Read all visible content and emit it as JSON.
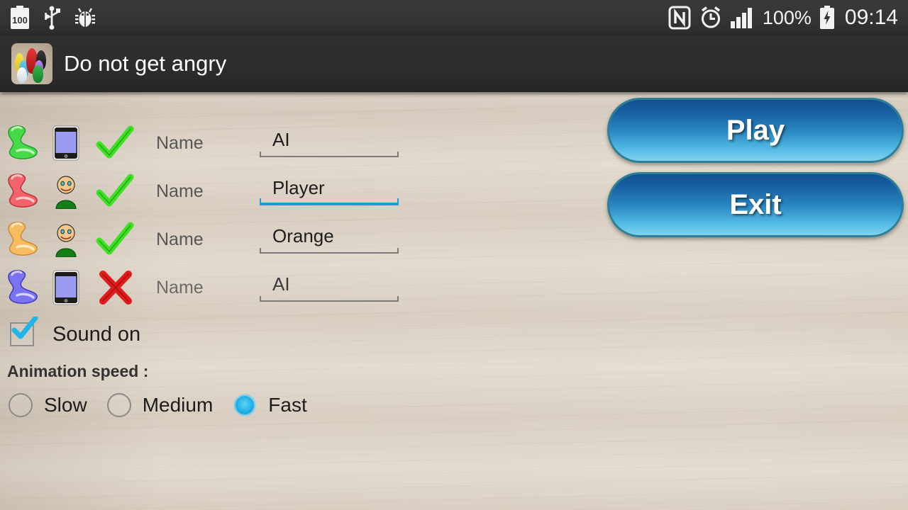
{
  "status_bar": {
    "left_icons": [
      {
        "name": "battery-100-icon",
        "label": "100"
      },
      {
        "name": "usb-icon",
        "label": "USB"
      },
      {
        "name": "debug-bug-icon",
        "label": "Debug"
      }
    ],
    "right_icons": [
      {
        "name": "nfc-icon",
        "label": "NFC"
      },
      {
        "name": "alarm-clock-icon",
        "label": "Alarm"
      },
      {
        "name": "signal-bars-icon",
        "label": "Signal"
      }
    ],
    "battery_percent": "100%",
    "charging_icon": "battery-charging-icon",
    "clock": "09:14"
  },
  "action_bar": {
    "app_icon": "game-pieces-icon",
    "title": "Do not get angry"
  },
  "players": [
    {
      "pawn_color": "#4ade4a",
      "pawn_name": "pawn-green",
      "type_icon": "phone-icon",
      "type": "AI",
      "enabled_icon": "green-check-icon",
      "enabled": true,
      "name_label": "Name",
      "name_value": "AI",
      "name_placeholder": "Name",
      "focused": false
    },
    {
      "pawn_color": "#f36a6a",
      "pawn_name": "pawn-red",
      "type_icon": "person-icon",
      "type": "Human",
      "enabled_icon": "green-check-icon",
      "enabled": true,
      "name_label": "Name",
      "name_value": "Player",
      "name_placeholder": "Name",
      "focused": true
    },
    {
      "pawn_color": "#f5b35c",
      "pawn_name": "pawn-orange",
      "type_icon": "person-icon",
      "type": "Human",
      "enabled_icon": "green-check-icon",
      "enabled": true,
      "name_label": "Name",
      "name_value": "Orange",
      "name_placeholder": "Name",
      "focused": false
    },
    {
      "pawn_color": "#7a72f0",
      "pawn_name": "pawn-blue",
      "type_icon": "phone-icon",
      "type": "AI",
      "enabled_icon": "red-cross-icon",
      "enabled": false,
      "name_label": "Name",
      "name_value": "AI",
      "name_placeholder": "Name",
      "focused": false
    }
  ],
  "sound": {
    "label": "Sound on",
    "checked": true,
    "check_icon": "checkmark-icon"
  },
  "animation_speed": {
    "label": "Animation speed :",
    "options": [
      {
        "label": "Slow",
        "selected": false
      },
      {
        "label": "Medium",
        "selected": false
      },
      {
        "label": "Fast",
        "selected": true
      }
    ],
    "selected": "Fast"
  },
  "buttons": {
    "play": "Play",
    "exit": "Exit"
  },
  "colors": {
    "accent_blue": "#1a9fd4",
    "button_border": "#2e7f96",
    "check_green": "#4dee2a",
    "cross_red": "#e01b1b",
    "status_bar_bg": "#343434",
    "action_bar_bg": "#2c2c2c",
    "wood_bg": "#ddd3c6"
  }
}
